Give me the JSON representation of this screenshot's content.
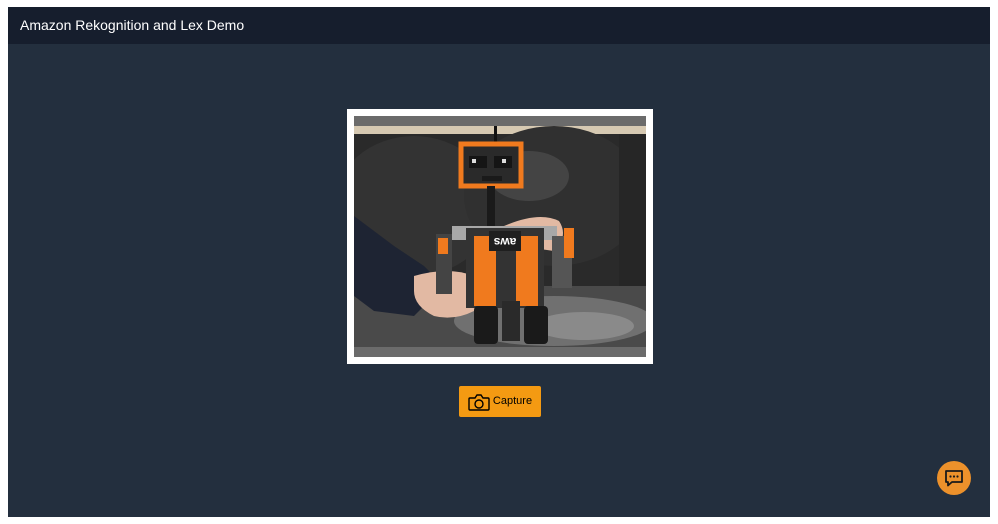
{
  "header": {
    "title": "Amazon Rekognition and Lex Demo"
  },
  "camera": {
    "preview_label": "camera-preview",
    "capture_label": "Capture",
    "capture_icon": "camera-icon"
  },
  "chat": {
    "icon": "chat-bubble-icon"
  },
  "colors": {
    "page_bg": "#232f3e",
    "header_bg": "#161e2d",
    "accent": "#f49a12",
    "chat_accent": "#ec912b"
  }
}
